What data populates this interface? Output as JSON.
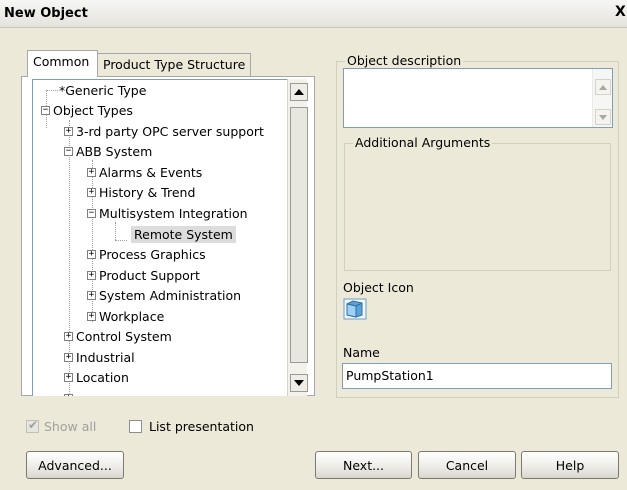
{
  "window": {
    "title": "New Object",
    "close_glyph": "X"
  },
  "tabs": [
    {
      "label": "Common",
      "active": true
    },
    {
      "label": "Product Type Structure",
      "active": false
    }
  ],
  "tree": {
    "items": [
      {
        "label": "*Generic Type",
        "expander": "none",
        "level": 0
      },
      {
        "label": "Object Types",
        "expander": "minus",
        "level": 0
      },
      {
        "label": "3-rd party OPC server support",
        "expander": "plus",
        "level": 1
      },
      {
        "label": "ABB System",
        "expander": "minus",
        "level": 1
      },
      {
        "label": "Alarms & Events",
        "expander": "plus",
        "level": 2
      },
      {
        "label": "History & Trend",
        "expander": "plus",
        "level": 2
      },
      {
        "label": "Multisystem Integration",
        "expander": "minus",
        "level": 2
      },
      {
        "label": "Remote System",
        "expander": "none",
        "level": 3,
        "selected": true
      },
      {
        "label": "Process Graphics",
        "expander": "plus",
        "level": 2
      },
      {
        "label": "Product Support",
        "expander": "plus",
        "level": 2
      },
      {
        "label": "System Administration",
        "expander": "plus",
        "level": 2
      },
      {
        "label": "Workplace",
        "expander": "plus",
        "level": 2
      },
      {
        "label": "Control System",
        "expander": "plus",
        "level": 1
      },
      {
        "label": "Industrial",
        "expander": "plus",
        "level": 1
      },
      {
        "label": "Location",
        "expander": "plus",
        "level": 1
      }
    ]
  },
  "description": {
    "legend": "Object description",
    "value": ""
  },
  "arguments": {
    "legend": "Additional Arguments"
  },
  "icon_section": {
    "label": "Object Icon",
    "icon": "object-cube-icon"
  },
  "name_section": {
    "label": "Name",
    "value": "PumpStation1"
  },
  "options": {
    "show_all_label": "Show all",
    "show_all_checked": true,
    "show_all_enabled": false,
    "list_presentation_label": "List presentation",
    "list_presentation_checked": false
  },
  "buttons": {
    "advanced": "Advanced...",
    "next": "Next...",
    "cancel": "Cancel",
    "help": "Help"
  }
}
